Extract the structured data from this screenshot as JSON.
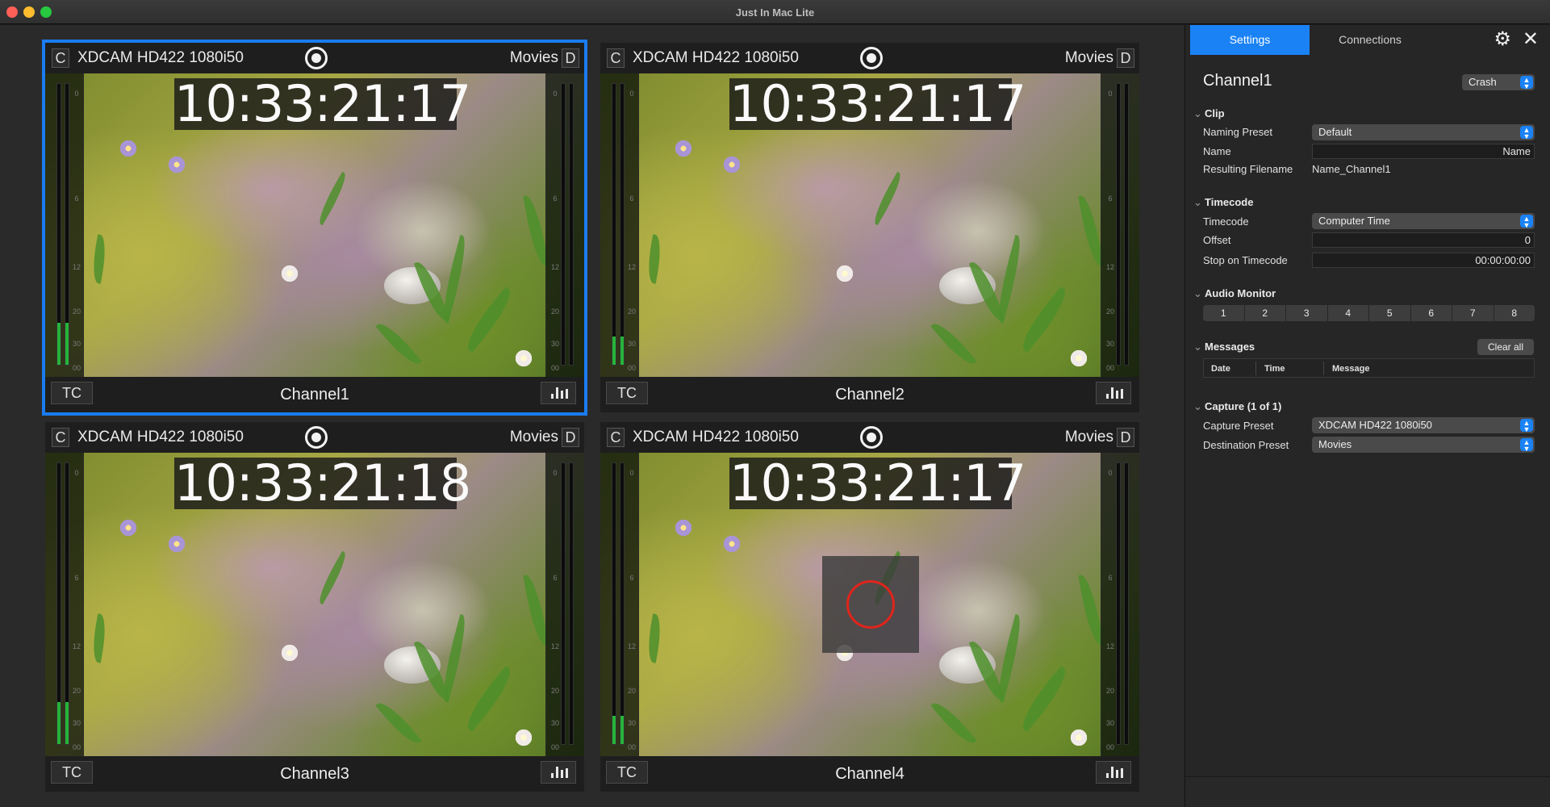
{
  "window": {
    "title": "Just In Mac Lite"
  },
  "tiles": [
    {
      "left_letter": "C",
      "preset": "XDCAM HD422 1080i50",
      "destination": "Movies",
      "right_letter": "D",
      "timecode": "10:33:21:17",
      "tc_label": "TC",
      "channel": "Channel1",
      "selected": true,
      "audio_level_left": 0.15,
      "audio_level_right": 0.0
    },
    {
      "left_letter": "C",
      "preset": "XDCAM HD422 1080i50",
      "destination": "Movies",
      "right_letter": "D",
      "timecode": "10:33:21:17",
      "tc_label": "TC",
      "channel": "Channel2",
      "selected": false,
      "audio_level_left": 0.1,
      "audio_level_right": 0.0
    },
    {
      "left_letter": "C",
      "preset": "XDCAM HD422 1080i50",
      "destination": "Movies",
      "right_letter": "D",
      "timecode": "10:33:21:18",
      "tc_label": "TC",
      "channel": "Channel3",
      "selected": false,
      "audio_level_left": 0.15,
      "audio_level_right": 0.0
    },
    {
      "left_letter": "C",
      "preset": "XDCAM HD422 1080i50",
      "destination": "Movies",
      "right_letter": "D",
      "timecode": "10:33:21:17",
      "tc_label": "TC",
      "channel": "Channel4",
      "selected": false,
      "audio_level_left": 0.1,
      "audio_level_right": 0.0
    }
  ],
  "meter_ticks": [
    "0",
    "6",
    "12",
    "20",
    "30",
    "00"
  ],
  "panel": {
    "tabs": [
      "Settings",
      "Connections"
    ],
    "active_tab": "Settings",
    "title": "Channel1",
    "crash_select": "Crash",
    "clip": {
      "header": "Clip",
      "naming_preset_label": "Naming Preset",
      "naming_preset_value": "Default",
      "name_label": "Name",
      "name_placeholder": "Name",
      "resulting_filename_label": "Resulting Filename",
      "resulting_filename_value": "Name_Channel1"
    },
    "timecode": {
      "header": "Timecode",
      "timecode_label": "Timecode",
      "timecode_value": "Computer Time",
      "offset_label": "Offset",
      "offset_value": "0",
      "stop_label": "Stop on Timecode",
      "stop_value": "00:00:00:00"
    },
    "audio_monitor": {
      "header": "Audio Monitor",
      "channels": [
        "1",
        "2",
        "3",
        "4",
        "5",
        "6",
        "7",
        "8"
      ]
    },
    "messages": {
      "header": "Messages",
      "clear_label": "Clear all",
      "columns": [
        "Date",
        "Time",
        "Message"
      ]
    },
    "capture": {
      "header": "Capture (1 of 1)",
      "capture_preset_label": "Capture Preset",
      "capture_preset_value": "XDCAM HD422 1080i50",
      "destination_preset_label": "Destination Preset",
      "destination_preset_value": "Movies"
    }
  },
  "colors": {
    "accent": "#1a82f5",
    "selected_outline": "#1a7cf0",
    "record_ring": "#e0241b",
    "meter_level": "#26b43a"
  },
  "icons": {
    "settings": "gear-icon",
    "close": "close-icon",
    "record": "record-icon",
    "audio_meter": "bar-chart-icon"
  }
}
